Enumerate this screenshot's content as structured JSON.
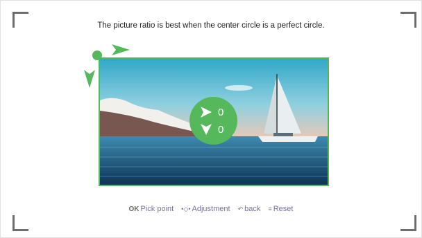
{
  "instruction": "The picture ratio is best when the center circle is a perfect circle.",
  "offset": {
    "x": "0",
    "y": "0"
  },
  "hints": {
    "pick_point": "Pick point",
    "adjustment": "Adjustment",
    "back": "back",
    "reset": "Reset"
  },
  "keys": {
    "ok": "OK"
  },
  "colors": {
    "accent": "#55b85a",
    "hint_text": "#7a70a0"
  }
}
